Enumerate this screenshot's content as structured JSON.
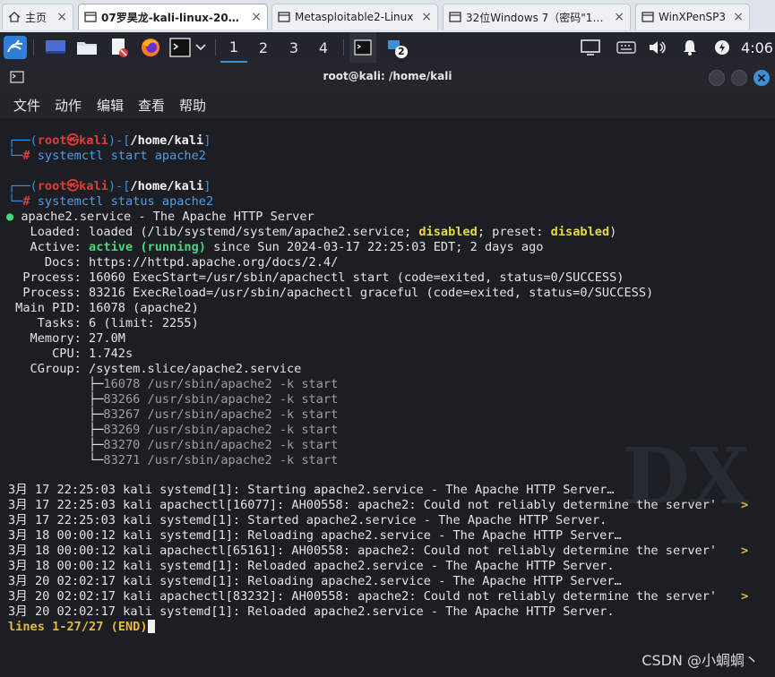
{
  "host_tabs": [
    {
      "label": "主页",
      "icon": "home-icon",
      "active": false
    },
    {
      "label": "07罗昊龙-kali-linux-2023....",
      "icon": "vm-icon",
      "active": true
    },
    {
      "label": "Metasploitable2-Linux",
      "icon": "vm-icon",
      "active": false
    },
    {
      "label": "32位Windows 7（密码\"1234...",
      "icon": "vm-icon",
      "active": false
    },
    {
      "label": "WinXPenSP3",
      "icon": "vm-icon",
      "active": false
    }
  ],
  "panel": {
    "workspaces": [
      "1",
      "2",
      "3",
      "4"
    ],
    "active_workspace": "1",
    "notification_count": "2",
    "clock": "4:06"
  },
  "terminal": {
    "title": "root@kali: /home/kali",
    "menu": [
      "文件",
      "动作",
      "编辑",
      "查看",
      "帮助"
    ],
    "prompt": {
      "open": "┌──(",
      "user": "root㉿kali",
      "mid": ")-[",
      "path": "/home/kali",
      "close": "]",
      "hash_line": "└─",
      "hash": "#"
    },
    "commands": [
      "systemctl start apache2",
      "systemctl status apache2"
    ],
    "status": {
      "dot": "●",
      "header": " apache2.service - The Apache HTTP Server",
      "loaded_label": "   Loaded: ",
      "loaded_a": "loaded (/lib/systemd/system/apache2.service; ",
      "loaded_disabled": "disabled",
      "loaded_b": "; preset: ",
      "loaded_preset": "disabled",
      "loaded_c": ")",
      "active_label": "   Active: ",
      "active_state": "active (running)",
      "active_rest": " since Sun 2024-03-17 22:25:03 EDT; 2 days ago",
      "docs": "     Docs: https://httpd.apache.org/docs/2.4/",
      "process1": "  Process: 16060 ExecStart=/usr/sbin/apachectl start (code=exited, status=0/SUCCESS)",
      "process2": "  Process: 83216 ExecReload=/usr/sbin/apachectl graceful (code=exited, status=0/SUCCESS)",
      "main_pid": " Main PID: 16078 (apache2)",
      "tasks": "    Tasks: 6 (limit: 2255)",
      "memory": "   Memory: 27.0M",
      "cpu": "      CPU: 1.742s",
      "cgroup": "   CGroup: /system.slice/apache2.service",
      "cgroup_tree": [
        {
          "branch": "           ├─",
          "text": "16078 /usr/sbin/apache2 -k start"
        },
        {
          "branch": "           ├─",
          "text": "83266 /usr/sbin/apache2 -k start"
        },
        {
          "branch": "           ├─",
          "text": "83267 /usr/sbin/apache2 -k start"
        },
        {
          "branch": "           ├─",
          "text": "83269 /usr/sbin/apache2 -k start"
        },
        {
          "branch": "           ├─",
          "text": "83270 /usr/sbin/apache2 -k start"
        },
        {
          "branch": "           └─",
          "text": "83271 /usr/sbin/apache2 -k start"
        }
      ]
    },
    "log": [
      {
        "text": "3月 17 22:25:03 kali systemd[1]: Starting apache2.service - The Apache HTTP Server…",
        "overflow": ""
      },
      {
        "text": "3月 17 22:25:03 kali apachectl[16077]: AH00558: apache2: Could not reliably determine the server'",
        "overflow": ">"
      },
      {
        "text": "3月 17 22:25:03 kali systemd[1]: Started apache2.service - The Apache HTTP Server.",
        "overflow": ""
      },
      {
        "text": "3月 18 00:00:12 kali systemd[1]: Reloading apache2.service - The Apache HTTP Server…",
        "overflow": ""
      },
      {
        "text": "3月 18 00:00:12 kali apachectl[65161]: AH00558: apache2: Could not reliably determine the server'",
        "overflow": ">"
      },
      {
        "text": "3月 18 00:00:12 kali systemd[1]: Reloaded apache2.service - The Apache HTTP Server.",
        "overflow": ""
      },
      {
        "text": "3月 20 02:02:17 kali systemd[1]: Reloading apache2.service - The Apache HTTP Server…",
        "overflow": ""
      },
      {
        "text": "3月 20 02:02:17 kali apachectl[83232]: AH00558: apache2: Could not reliably determine the server'",
        "overflow": ">"
      },
      {
        "text": "3月 20 02:02:17 kali systemd[1]: Reloaded apache2.service - The Apache HTTP Server.",
        "overflow": ""
      }
    ],
    "pager_status": "lines 1-27/27 (END)"
  },
  "watermark": "CSDN @小蜩蜩丶",
  "colors": {
    "prompt_blue": "#3f8ed8",
    "prompt_red": "#e03b35",
    "active_green": "#45d87b",
    "disabled_yellow": "#e5d94e"
  }
}
